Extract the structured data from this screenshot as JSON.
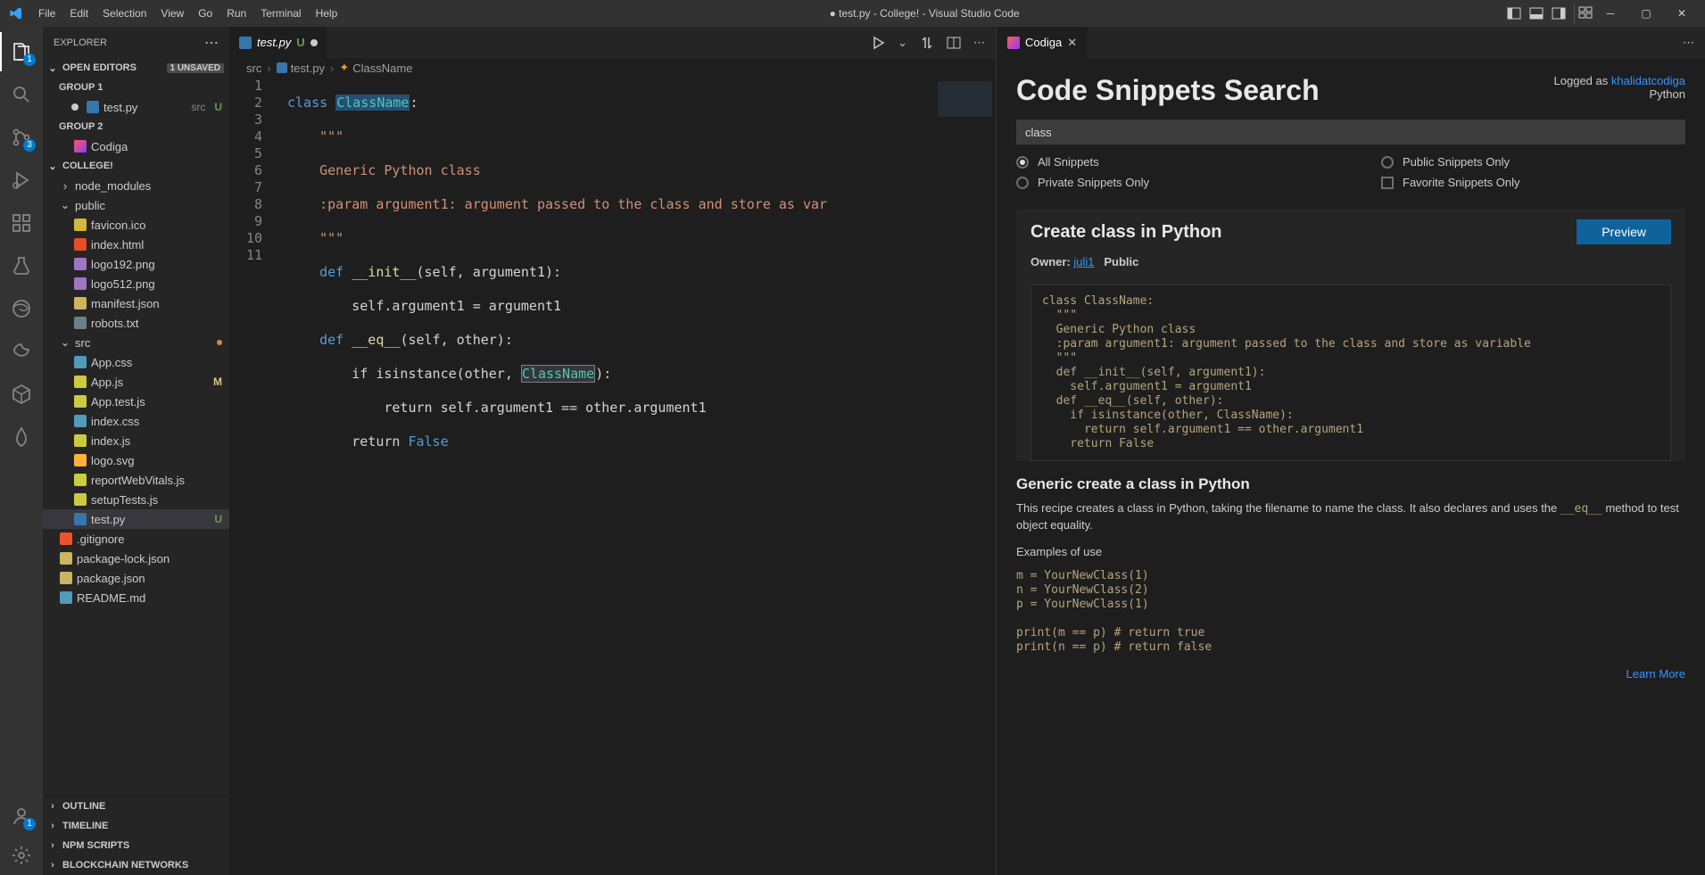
{
  "window": {
    "title": "● test.py - College! - Visual Studio Code"
  },
  "menu": [
    "File",
    "Edit",
    "Selection",
    "View",
    "Go",
    "Run",
    "Terminal",
    "Help"
  ],
  "activity": {
    "explorer_badge": "1",
    "scm_badge": "3",
    "accounts_badge": "1"
  },
  "explorer": {
    "title": "EXPLORER",
    "open_editors": "OPEN EDITORS",
    "unsaved": "1 UNSAVED",
    "group1": "GROUP 1",
    "group2": "GROUP 2",
    "open_editor_file": "test.py",
    "open_editor_folder": "src",
    "open_editor_deco": "U",
    "codiga_item": "Codiga",
    "project": "COLLEGE!",
    "folders": {
      "node_modules": "node_modules",
      "public": "public",
      "src": "src"
    },
    "public_files": [
      {
        "name": "favicon.ico",
        "cls": "fi-ico"
      },
      {
        "name": "index.html",
        "cls": "fi-html"
      },
      {
        "name": "logo192.png",
        "cls": "fi-png"
      },
      {
        "name": "logo512.png",
        "cls": "fi-png"
      },
      {
        "name": "manifest.json",
        "cls": "fi-json"
      },
      {
        "name": "robots.txt",
        "cls": "fi-txt"
      }
    ],
    "src_files": [
      {
        "name": "App.css",
        "cls": "fi-css",
        "deco": ""
      },
      {
        "name": "App.js",
        "cls": "fi-js",
        "deco": "M"
      },
      {
        "name": "App.test.js",
        "cls": "fi-js",
        "deco": ""
      },
      {
        "name": "index.css",
        "cls": "fi-css",
        "deco": ""
      },
      {
        "name": "index.js",
        "cls": "fi-js",
        "deco": ""
      },
      {
        "name": "logo.svg",
        "cls": "fi-svg",
        "deco": ""
      },
      {
        "name": "reportWebVitals.js",
        "cls": "fi-js",
        "deco": ""
      },
      {
        "name": "setupTests.js",
        "cls": "fi-js",
        "deco": ""
      },
      {
        "name": "test.py",
        "cls": "fi-py",
        "deco": "U",
        "sel": true
      }
    ],
    "root_files": [
      {
        "name": ".gitignore",
        "cls": "fi-git"
      },
      {
        "name": "package-lock.json",
        "cls": "fi-json"
      },
      {
        "name": "package.json",
        "cls": "fi-json"
      },
      {
        "name": "README.md",
        "cls": "fi-md"
      }
    ],
    "panels": [
      "OUTLINE",
      "TIMELINE",
      "NPM SCRIPTS",
      "BLOCKCHAIN NETWORKS"
    ]
  },
  "tabs": {
    "active": "test.py",
    "deco": "U"
  },
  "breadcrumb": {
    "a": "src",
    "b": "test.py",
    "c": "ClassName"
  },
  "code": {
    "lines": [
      "1",
      "2",
      "3",
      "4",
      "5",
      "6",
      "7",
      "8",
      "9",
      "10",
      "11"
    ],
    "l1_kw": "class ",
    "l1_cls": "ClassName",
    "l1_tail": ":",
    "l2": "    \"\"\"",
    "l3": "    Generic Python class",
    "l4": "    :param argument1: argument passed to the class and store as var",
    "l5": "    \"\"\"",
    "l6_kw": "    def ",
    "l6_fn": "__init__",
    "l6_tail": "(self, argument1):",
    "l7": "        self.argument1 = argument1",
    "l8_kw": "    def ",
    "l8_fn": "__eq__",
    "l8_tail": "(self, other):",
    "l9a": "        if isinstance(other, ",
    "l9_box": "ClassName",
    "l9b": "):",
    "l10a": "            return self.argument1 == other.argument1",
    "l11a": "        return ",
    "l11_false": "False"
  },
  "codiga": {
    "tab": "Codiga",
    "title": "Code Snippets Search",
    "logged_as": "Logged as ",
    "user": "khalidatcodiga",
    "lang": "Python",
    "search_value": "class",
    "filters": {
      "all": "All Snippets",
      "private": "Private Snippets Only",
      "public": "Public Snippets Only",
      "fav": "Favorite Snippets Only"
    },
    "snippet_title": "Create class in Python",
    "preview": "Preview",
    "owner_label": "Owner: ",
    "owner": "juli1",
    "visibility": "Public",
    "snippet_code": "class ClassName:\n  \"\"\"\n  Generic Python class\n  :param argument1: argument passed to the class and store as variable\n  \"\"\"\n  def __init__(self, argument1):\n    self.argument1 = argument1\n  def __eq__(self, other):\n    if isinstance(other, ClassName):\n      return self.argument1 == other.argument1\n    return False",
    "generic_title": "Generic create a class in Python",
    "para_a": "This recipe creates a class in Python, taking the filename to name the class. It also declares and uses the ",
    "para_code": "__eq__",
    "para_b": " method to test object equality.",
    "examples_label": "Examples of use",
    "examples": "m = YourNewClass(1)\nn = YourNewClass(2)\np = YourNewClass(1)\n\nprint(m == p) # return true\nprint(n == p) # return false",
    "learn_more": "Learn More"
  }
}
